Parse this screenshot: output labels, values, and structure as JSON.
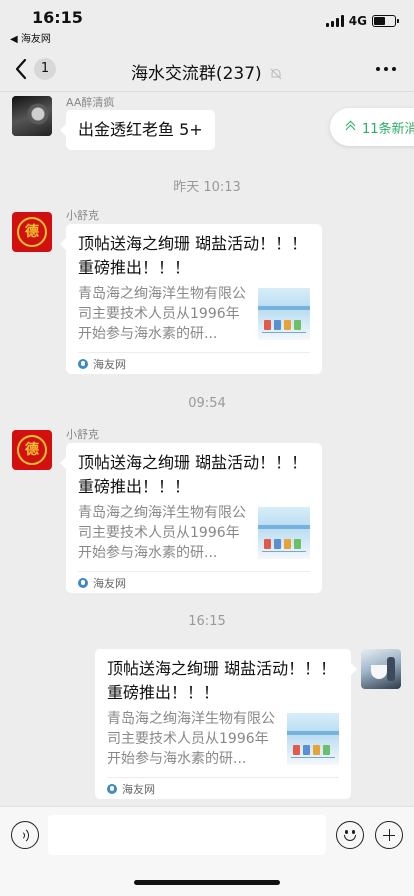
{
  "status_bar": {
    "time": "16:15",
    "back_app": "◀ 海友网",
    "network": "4G",
    "battery_level": 0.55
  },
  "nav": {
    "unread_count": "1",
    "title": "海水交流群(237)"
  },
  "new_messages_pill": "11条新消",
  "messages": [
    {
      "sender": "AA醉清疯",
      "text": "出金透红老鱼 5+"
    },
    {
      "time": "昨天 10:13"
    },
    {
      "sender": "小舒克",
      "card": {
        "title": "顶帖送海之绚珊 瑚盐活动！！！ 重磅推出！！！",
        "desc": "青岛海之绚海洋生物有限公司主要技术人员从1996年开始参与海水素的研...",
        "source": "海友网"
      }
    },
    {
      "time": "09:54"
    },
    {
      "sender": "小舒克",
      "card": {
        "title": "顶帖送海之绚珊 瑚盐活动！！！ 重磅推出！！！",
        "desc": "青岛海之绚海洋生物有限公司主要技术人员从1996年开始参与海水素的研...",
        "source": "海友网"
      }
    },
    {
      "time": "16:15"
    },
    {
      "sender": "me",
      "card": {
        "title": "顶帖送海之绚珊 瑚盐活动！！！ 重磅推出！！！",
        "desc": "青岛海之绚海洋生物有限公司主要技术人员从1996年开始参与海水素的研...",
        "source": "海友网"
      }
    }
  ],
  "input": {
    "value": ""
  },
  "colors": {
    "accent_green": "#2aae67",
    "background": "#ededed",
    "avatar_red": "#d31010"
  }
}
